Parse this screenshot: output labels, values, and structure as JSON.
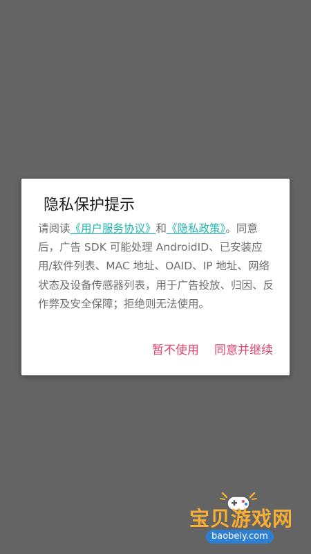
{
  "colors": {
    "scrim": "#646464",
    "dialog_bg": "#ffffff",
    "link": "#1fb5ad",
    "action": "#e2456c",
    "watermark_text": "#f6ae35",
    "watermark_url_bg": "#2f7fd0"
  },
  "dialog": {
    "title": "隐私保护提示",
    "body": {
      "prefix": "请阅读",
      "user_agreement_link": "《用户服务协议》",
      "connector": "和",
      "privacy_policy_link": "《隐私政策》",
      "suffix": "。同意后，广告 SDK 可能处理 AndroidID、已安装应用/软件列表、MAC 地址、OAID、IP 地址、网络状态及设备传感器列表，用于广告投放、归因、反作弊及安全保障；拒绝则无法使用。"
    },
    "actions": {
      "decline_label": "暂不使用",
      "accept_label": "同意并继续"
    }
  },
  "watermark": {
    "title": "宝贝游戏网",
    "url": "baobeiy.com",
    "logo_icon": "gamepad-icon"
  }
}
